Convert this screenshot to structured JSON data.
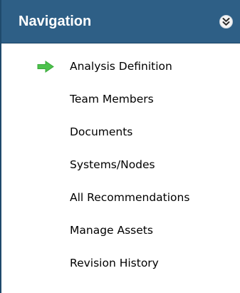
{
  "navigation": {
    "title": "Navigation",
    "collapse_icon": "double-chevron-down-icon",
    "accent_color": "#2e5f86",
    "active_arrow_color": "#4cc24c",
    "items": [
      {
        "label": "Analysis Definition",
        "active": true
      },
      {
        "label": "Team Members",
        "active": false
      },
      {
        "label": "Documents",
        "active": false
      },
      {
        "label": "Systems/Nodes",
        "active": false
      },
      {
        "label": "All Recommendations",
        "active": false
      },
      {
        "label": "Manage Assets",
        "active": false
      },
      {
        "label": "Revision History",
        "active": false
      }
    ]
  }
}
